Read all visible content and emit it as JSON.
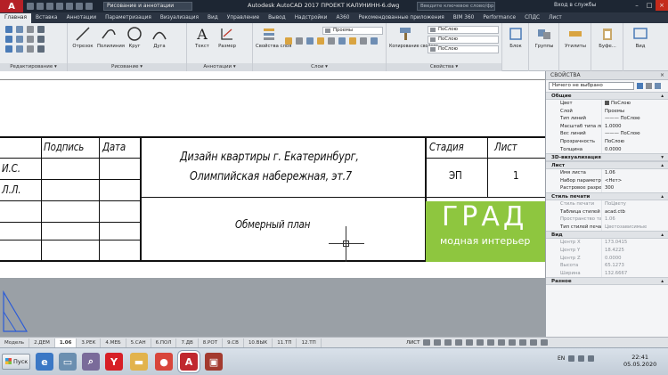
{
  "titlebar": {
    "app_letter": "A",
    "workspace": "Рисование и аннотации",
    "title": "Autodesk AutoCAD 2017   ПРОЕКТ КАЛУНИНН-6.dwg",
    "search_placeholder": "Введите ключевое слово/фразу",
    "signin": "Вход в службы",
    "min": "–",
    "max": "□",
    "close": "×"
  },
  "ribbon_tabs": [
    "Главная",
    "Вставка",
    "Аннотации",
    "Параметризация",
    "Визуализация",
    "Вид",
    "Управление",
    "Вывод",
    "Надстройки",
    "А360",
    "Рекомендованные приложения",
    "BIM 360",
    "Performance",
    "СПДС",
    "Лист"
  ],
  "ribbon": {
    "draw_tools": [
      "Отрезок",
      "Полилиния",
      "Круг",
      "Дуга"
    ],
    "text_tool": "Текст",
    "dim_tool": "Размер",
    "layer_props": "Свойства слоя",
    "layer_combo": "Проемы",
    "copy_props": "Копирование свойств",
    "bylayer": [
      "ПоСлою",
      "ПоСлою",
      "ПоСлою"
    ],
    "block": "Блок",
    "groups": "Группы",
    "utilities": "Утилиты",
    "buffer": "Буфе...",
    "view": "Вид",
    "panel_titles": {
      "modify": "Редактирование ▾",
      "draw": "Рисование ▾",
      "annotation": "Аннотации ▾",
      "layers": "Слои ▾",
      "properties": "Свойства ▾"
    }
  },
  "stamp": {
    "col_signature": "Подпись",
    "col_date": "Дата",
    "left_name1": "И.С.",
    "left_name2": "Л.Л.",
    "title_line1": "Дизайн квартиры г. Екатеринбург,",
    "title_line2": "Олимпийская набережная, эт.7",
    "col_stage": "Стадия",
    "col_sheet": "Лист",
    "stage_value": "ЭП",
    "sheet_value": "1",
    "sheet_title": "Обмерный план",
    "logo_big": "ГРАД",
    "logo_small": "модная интерьер"
  },
  "properties": {
    "header": "СВОЙСТВА",
    "selection": "Ничего не выбрано",
    "sections": {
      "general": "Общие",
      "viz3d": "3D-визуализация",
      "sheet": "Лист",
      "print_style": "Стиль печати",
      "view": "Вид",
      "misc": "Разное"
    },
    "general_rows": [
      {
        "k": "Цвет",
        "v": "ПоСлою"
      },
      {
        "k": "Слой",
        "v": "Проемы"
      },
      {
        "k": "Тип линий",
        "v": "——— ПоСлою"
      },
      {
        "k": "Масштаб типа лин...",
        "v": "1.0000"
      },
      {
        "k": "Вес линий",
        "v": "——— ПоСлою"
      },
      {
        "k": "Прозрачность",
        "v": "ПоСлою"
      },
      {
        "k": "Толщина",
        "v": "0.0000"
      }
    ],
    "sheet_rows": [
      {
        "k": "Имя листа",
        "v": "1.06"
      },
      {
        "k": "Набор параметров...",
        "v": "<Нет>"
      },
      {
        "k": "Растровое разре...",
        "v": "300"
      }
    ],
    "print_rows": [
      {
        "k": "Стиль печати",
        "v": "ПоЦвету"
      },
      {
        "k": "Таблица стилей п...",
        "v": "acad.ctb"
      },
      {
        "k": "Пространство таб...",
        "v": "1.06"
      },
      {
        "k": "Тип стилей печати",
        "v": "Цветозависимые"
      }
    ],
    "view_rows": [
      {
        "k": "Центр X",
        "v": "173.0415"
      },
      {
        "k": "Центр Y",
        "v": "18.4225"
      },
      {
        "k": "Центр Z",
        "v": "0.0000"
      },
      {
        "k": "Высота",
        "v": "65.1273"
      },
      {
        "k": "Ширина",
        "v": "132.6667"
      }
    ]
  },
  "layout_tabs": [
    "Модель",
    "2.ДЕМ",
    "1.06",
    "3.РЕК",
    "4.МЕБ",
    "5.САН",
    "6.ПОЛ",
    "7.ДВ",
    "8.РОТ",
    "9.СВ",
    "10.ВЫК",
    "11.ТП",
    "12.ТП"
  ],
  "active_layout": "1.06",
  "status": {
    "mode": "ЛИСТ"
  },
  "taskbar": {
    "start": "Пуск",
    "lang": "EN",
    "time": "22:41",
    "date": "05.05.2020"
  },
  "colors": {
    "accent": "#8ec63f",
    "titlebar": "#1d2633",
    "autocad_red": "#b52027"
  }
}
